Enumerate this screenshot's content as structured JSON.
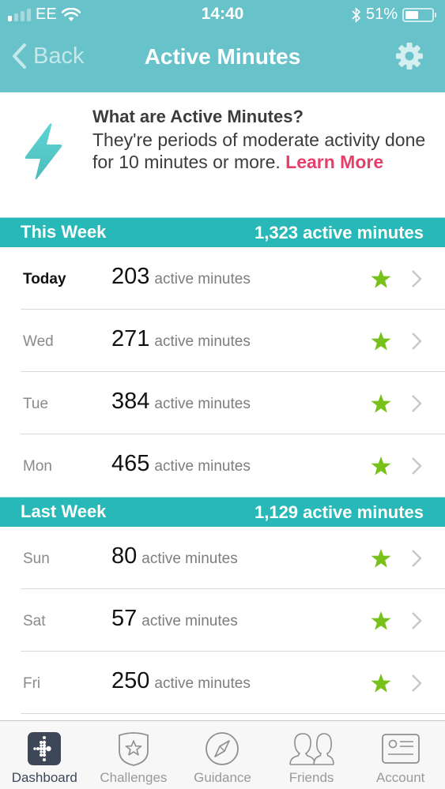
{
  "status_bar": {
    "carrier": "EE",
    "signal_bars_filled": 1,
    "signal_bars_total": 4,
    "time": "14:40",
    "battery_percent_label": "51%",
    "battery_level": 0.51
  },
  "nav": {
    "back_label": "Back",
    "title": "Active Minutes",
    "settings_icon": "gear-icon"
  },
  "info": {
    "icon": "lightning-bolt-icon",
    "title": "What are Active Minutes?",
    "body": "They're periods of moderate activity done for 10 minutes or more.",
    "link_label": "Learn More"
  },
  "sections": [
    {
      "label": "This Week",
      "total": "1,323 active minutes",
      "rows": [
        {
          "day": "Today",
          "value": "203",
          "unit": "active minutes",
          "goal_met": true
        },
        {
          "day": "Wed",
          "value": "271",
          "unit": "active minutes",
          "goal_met": true
        },
        {
          "day": "Tue",
          "value": "384",
          "unit": "active minutes",
          "goal_met": true
        },
        {
          "day": "Mon",
          "value": "465",
          "unit": "active minutes",
          "goal_met": true
        }
      ]
    },
    {
      "label": "Last Week",
      "total": "1,129 active minutes",
      "rows": [
        {
          "day": "Sun",
          "value": "80",
          "unit": "active minutes",
          "goal_met": true
        },
        {
          "day": "Sat",
          "value": "57",
          "unit": "active minutes",
          "goal_met": true
        },
        {
          "day": "Fri",
          "value": "250",
          "unit": "active minutes",
          "goal_met": true
        }
      ]
    }
  ],
  "tabbar": {
    "items": [
      {
        "label": "Dashboard",
        "icon": "dashboard-icon",
        "active": true
      },
      {
        "label": "Challenges",
        "icon": "challenges-badge-icon",
        "active": false
      },
      {
        "label": "Guidance",
        "icon": "compass-icon",
        "active": false
      },
      {
        "label": "Friends",
        "icon": "friends-icon",
        "active": false
      },
      {
        "label": "Account",
        "icon": "account-card-icon",
        "active": false
      }
    ]
  },
  "colors": {
    "header": "#67c2c9",
    "section_header": "#28b8b7",
    "accent_link": "#e53f6a",
    "star": "#77c11a",
    "active_tab": "#3e4757"
  }
}
